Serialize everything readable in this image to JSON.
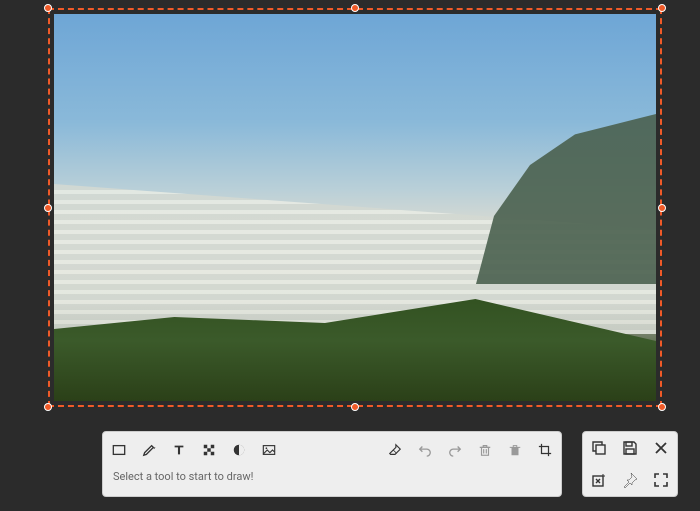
{
  "hint": "Select a tool to start to draw!",
  "accent_color": "#f05a28",
  "toolbar": {
    "left": [
      {
        "name": "rectangle-icon"
      },
      {
        "name": "pencil-icon"
      },
      {
        "name": "text-icon"
      },
      {
        "name": "pixelate-icon"
      },
      {
        "name": "invert-icon"
      },
      {
        "name": "image-icon"
      }
    ],
    "right": [
      {
        "name": "eraser-icon"
      },
      {
        "name": "undo-icon",
        "disabled": true
      },
      {
        "name": "redo-icon",
        "disabled": true
      },
      {
        "name": "delete-icon",
        "disabled": true
      },
      {
        "name": "delete-all-icon",
        "disabled": true
      },
      {
        "name": "crop-icon"
      }
    ]
  },
  "sidepanel": [
    {
      "name": "copy-icon"
    },
    {
      "name": "save-icon"
    },
    {
      "name": "close-icon"
    },
    {
      "name": "discard-icon"
    },
    {
      "name": "pin-icon"
    },
    {
      "name": "fullscreen-icon"
    }
  ]
}
